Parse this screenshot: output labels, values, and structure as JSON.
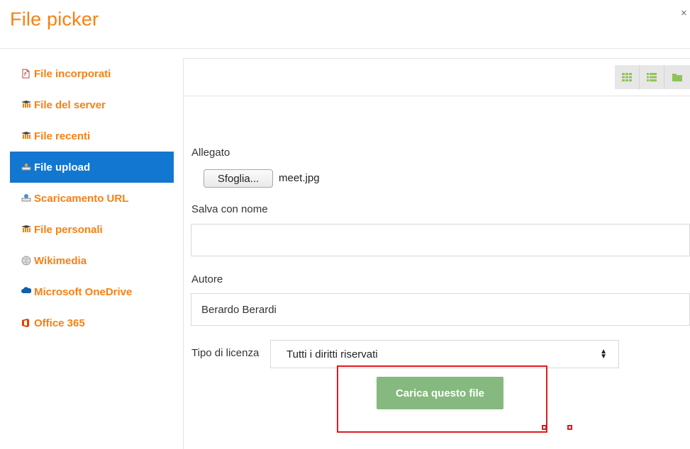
{
  "dialog": {
    "title": "File picker",
    "close_label": "×"
  },
  "sidebar": {
    "items": [
      {
        "label": "File incorporati",
        "icon": "file-embedded-icon",
        "active": false
      },
      {
        "label": "File del server",
        "icon": "moodle-icon",
        "active": false
      },
      {
        "label": "File recenti",
        "icon": "moodle-icon",
        "active": false
      },
      {
        "label": "File upload",
        "icon": "upload-icon",
        "active": true
      },
      {
        "label": "Scaricamento URL",
        "icon": "url-download-icon",
        "active": false
      },
      {
        "label": "File personali",
        "icon": "moodle-icon",
        "active": false
      },
      {
        "label": "Wikimedia",
        "icon": "wikimedia-globe-icon",
        "active": false
      },
      {
        "label": "Microsoft OneDrive",
        "icon": "onedrive-cloud-icon",
        "active": false
      },
      {
        "label": "Office 365",
        "icon": "office365-icon",
        "active": false
      }
    ]
  },
  "toolbar": {
    "views": [
      "grid-view-icon",
      "list-view-icon",
      "folder-view-icon"
    ]
  },
  "form": {
    "attachment_label": "Allegato",
    "browse_label": "Sfoglia...",
    "selected_file": "meet.jpg",
    "save_as_label": "Salva con nome",
    "save_as_value": "",
    "author_label": "Autore",
    "author_value": "Berardo Berardi",
    "license_label": "Tipo di licenza",
    "license_value": "Tutti i diritti riservati",
    "upload_label": "Carica questo file"
  },
  "colors": {
    "brand": "#f98012",
    "active": "#1177d1",
    "upload_button": "#85b97f",
    "annotation": "#e0191e"
  }
}
